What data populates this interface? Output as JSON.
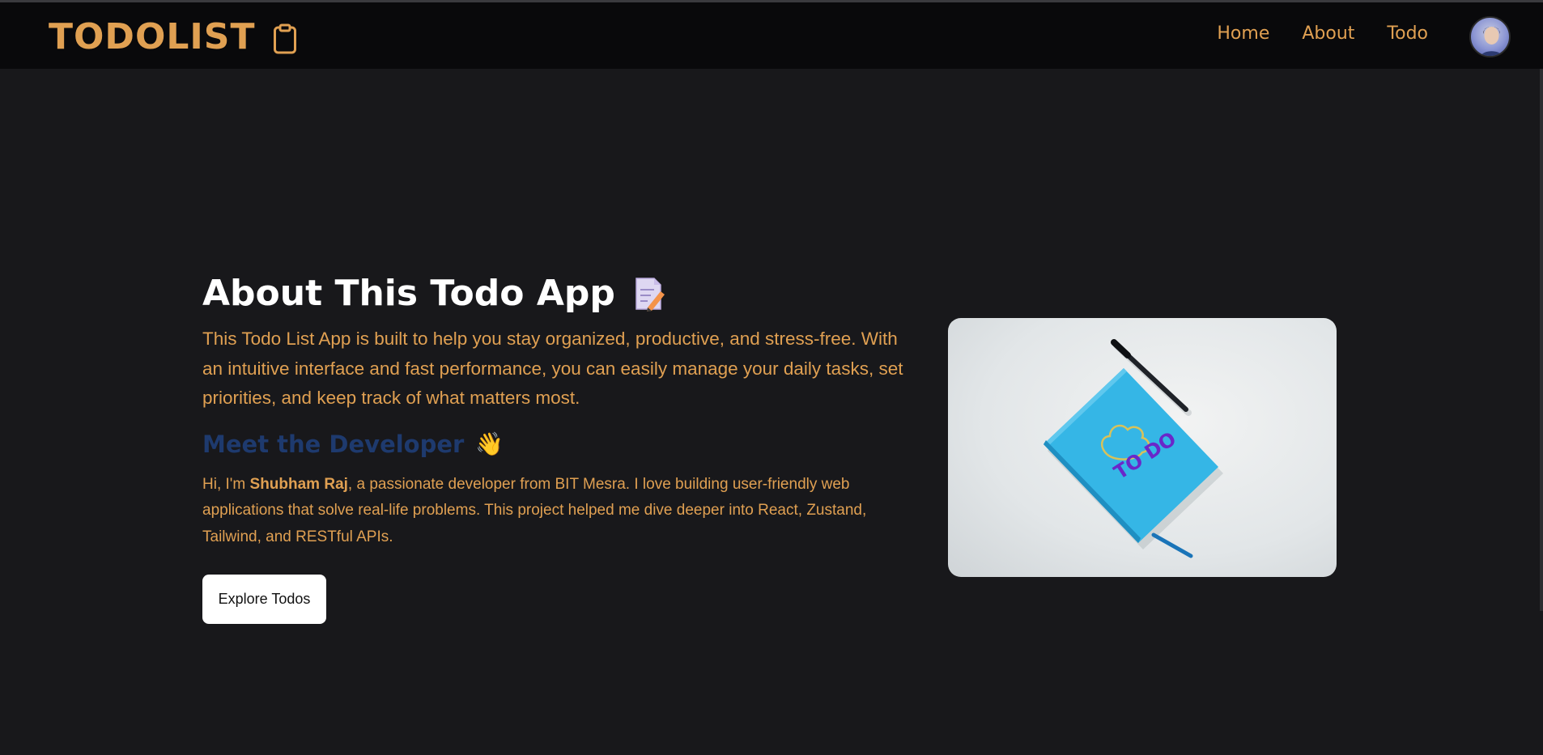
{
  "navbar": {
    "brand": "TODOLIST",
    "links": [
      "Home",
      "About",
      "Todo"
    ]
  },
  "about": {
    "title": "About This Todo App",
    "intro": "This Todo List App is built to help you stay organized, productive, and stress-free. With an intuitive interface and fast performance, you can easily manage your daily tasks, set priorities, and keep track of what matters most.",
    "developer_heading": "Meet the Developer",
    "developer_heading_emoji": "👋",
    "bio_prefix": "Hi, I'm ",
    "bio_name": "Shubham Raj",
    "bio_suffix": ", a passionate developer from BIT Mesra. I love building user-friendly web applications that solve real-life problems. This project helped me dive deeper into React, Zustand, Tailwind, and RESTful APIs.",
    "cta_label": "Explore Todos"
  },
  "image": {
    "notebook_text": "TO DO"
  },
  "colors": {
    "background": "#18181b",
    "navbar": "#09090b",
    "accent": "#e0a052",
    "heading": "#ffffff",
    "subheading": "#1e3a6e",
    "notebook": "#35b6e6"
  },
  "icons": {
    "brand": "clipboard-icon",
    "title": "memo-icon",
    "subheading": "waving-hand-icon"
  }
}
